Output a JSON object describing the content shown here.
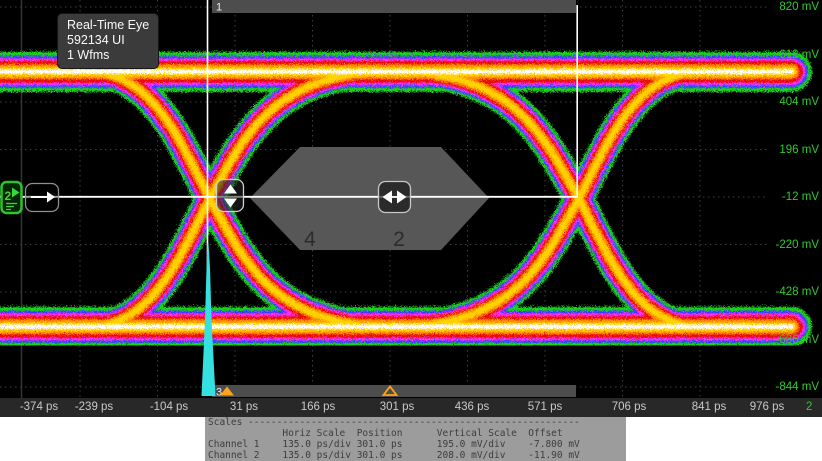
{
  "eye_overlay": {
    "title": "Real-Time Eye",
    "ui_count": "592134 UI",
    "waveforms": "1 Wfms"
  },
  "voltage_axis": {
    "unit": "mV",
    "labels": [
      "820 mV",
      "612 mV",
      "404 mV",
      "196 mV",
      "-12 mV",
      "-220 mV",
      "-428 mV",
      "-636 mV",
      "-844 mV"
    ],
    "color": "#2ecc2e"
  },
  "time_axis": {
    "unit": "ps",
    "labels": [
      "-374 ps",
      "-239 ps",
      "-104 ps",
      "31 ps",
      "166 ps",
      "301 ps",
      "436 ps",
      "571 ps",
      "706 ps",
      "841 ps",
      "976 ps"
    ],
    "channel_indicator": "2"
  },
  "mask": {
    "region_top": "1",
    "region_bottom": "3",
    "region_hex_left": "4",
    "region_hex_center": "2"
  },
  "channel_badge": {
    "label": "2"
  },
  "scales_table": {
    "title": "Scales",
    "columns": [
      "Horiz Scale",
      "Position",
      "Vertical Scale",
      "Offset"
    ],
    "rows": [
      {
        "name": "Channel 1",
        "horiz_scale": "135.0 ps/div",
        "position": "301.0 ps",
        "vertical_scale": "195.0 mV/div",
        "offset": "-7.800 mV"
      },
      {
        "name": "Channel 2",
        "horiz_scale": "135.0 ps/div",
        "position": "301.0 ps",
        "vertical_scale": "208.0 mV/div",
        "offset": "-11.90 mV"
      }
    ],
    "display_lines": [
      "Scales ----------------------------------------------------------",
      "             Horiz Scale  Position      Vertical Scale  Offset",
      "Channel 1    135.0 ps/div 301.0 ps      195.0 mV/div    -7.800 mV",
      "Channel 2    135.0 ps/div 301.0 ps      208.0 mV/div    -11.90 mV"
    ]
  },
  "colors": {
    "trace_palette": [
      "#1fd11f",
      "#3a3aff",
      "#ff30ff",
      "#e81010",
      "#ff8c00",
      "#ffd200",
      "#ffffff"
    ],
    "histogram_cyan": "#35e0e0",
    "mask_gray": "#575757",
    "marker_orange": "#ffa31a",
    "axis_green": "#2ecc2e"
  },
  "chart_data": {
    "type": "eye-diagram",
    "title": "Real-Time Eye",
    "x_axis": {
      "unit": "ps",
      "ticks": [
        -374,
        -239,
        -104,
        31,
        166,
        301,
        436,
        571,
        706,
        841,
        976
      ],
      "scale": "135.0 ps/div",
      "position": "301.0 ps"
    },
    "y_axis": {
      "unit": "mV",
      "ticks": [
        820,
        612,
        404,
        196,
        -12,
        -220,
        -428,
        -636,
        -844
      ],
      "ch1_scale": "195.0 mV/div",
      "ch2_scale": "208.0 mV/div"
    },
    "eye": {
      "crossing_level_mV": -12,
      "high_level_mV": 540,
      "low_level_mV": -570,
      "ui_count": 592134,
      "waveform_count": 1
    },
    "annotations": [
      "mask region 1 (top bar)",
      "mask region 3 (bottom bar)",
      "hexagonal mask regions 4 and 2",
      "cyan crossing-time histogram at left crossing"
    ]
  }
}
